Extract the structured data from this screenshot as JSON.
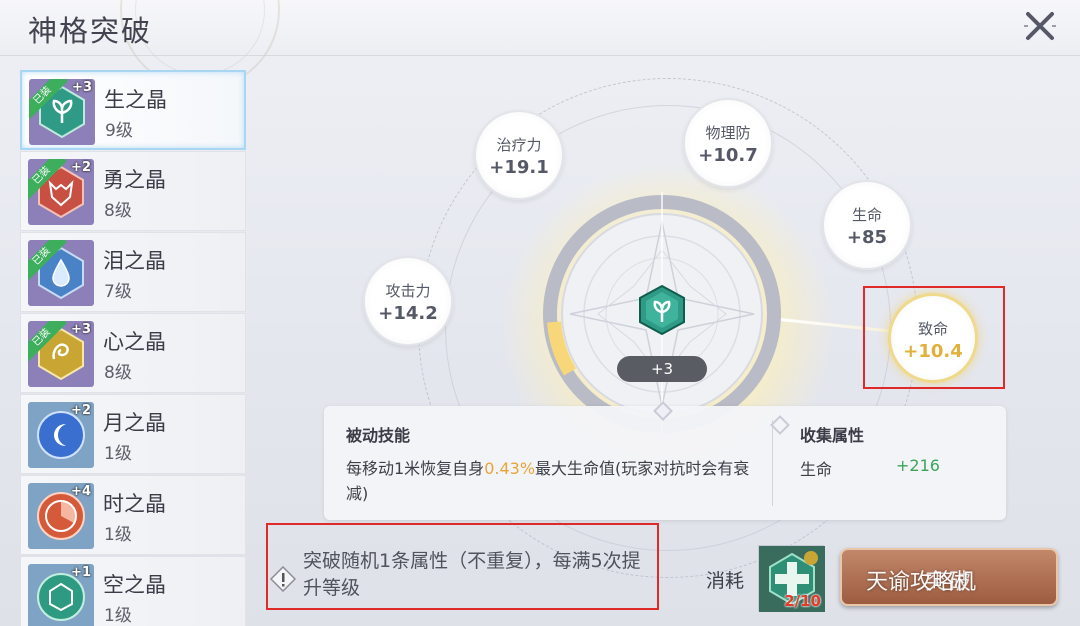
{
  "header": {
    "title": "神格突破"
  },
  "sidebar": {
    "items": [
      {
        "name": "生之晶",
        "level": "9级",
        "plus": "+3",
        "equipped": "已装",
        "icon": "leaf-crystal-icon",
        "color": "#2f9b86"
      },
      {
        "name": "勇之晶",
        "level": "8级",
        "plus": "+2",
        "equipped": "已装",
        "icon": "wolf-crystal-icon",
        "color": "#c85043"
      },
      {
        "name": "泪之晶",
        "level": "7级",
        "plus": "",
        "equipped": "已装",
        "icon": "drop-crystal-icon",
        "color": "#4a82c8"
      },
      {
        "name": "心之晶",
        "level": "8级",
        "plus": "+3",
        "equipped": "已装",
        "icon": "heart-crystal-icon",
        "color": "#c9a634"
      },
      {
        "name": "月之晶",
        "level": "1级",
        "plus": "+2",
        "equipped": "",
        "icon": "moon-crystal-icon",
        "color": "#3a6fd0"
      },
      {
        "name": "时之晶",
        "level": "1级",
        "plus": "+4",
        "equipped": "",
        "icon": "time-crystal-icon",
        "color": "#d45a3a"
      },
      {
        "name": "空之晶",
        "level": "1级",
        "plus": "+1",
        "equipped": "",
        "icon": "space-crystal-icon",
        "color": "#2f9a82"
      }
    ]
  },
  "stats": {
    "attack": {
      "label": "攻击力",
      "value": "+14.2"
    },
    "heal": {
      "label": "治疗力",
      "value": "+19.1"
    },
    "pdef": {
      "label": "物理防",
      "value": "+10.7"
    },
    "hp": {
      "label": "生命",
      "value": "+85"
    },
    "crit": {
      "label": "致命",
      "value": "+10.4"
    }
  },
  "center": {
    "level": "+3",
    "icon": "leaf-crystal-icon"
  },
  "panel": {
    "passive_title": "被动技能",
    "passive_text_1": "每移动1米恢复自身",
    "passive_highlight": "0.43%",
    "passive_text_2": "最大生命值(玩家对抗时会有衰减)",
    "collect_title": "收集属性",
    "collect_stat_name": "生命",
    "collect_stat_value": "+216"
  },
  "bottom": {
    "warning": "突破随机1条属性（不重复），每满5次提升等级",
    "cost_label": "消耗",
    "cost_count": "2/10",
    "button_label": "突破",
    "watermark": "天谕攻略机"
  },
  "colors": {
    "accent_gold": "#e0b03a",
    "positive_green": "#3aa55a",
    "highlight_orange": "#e8a43a",
    "alert_red": "#e02a2a"
  }
}
